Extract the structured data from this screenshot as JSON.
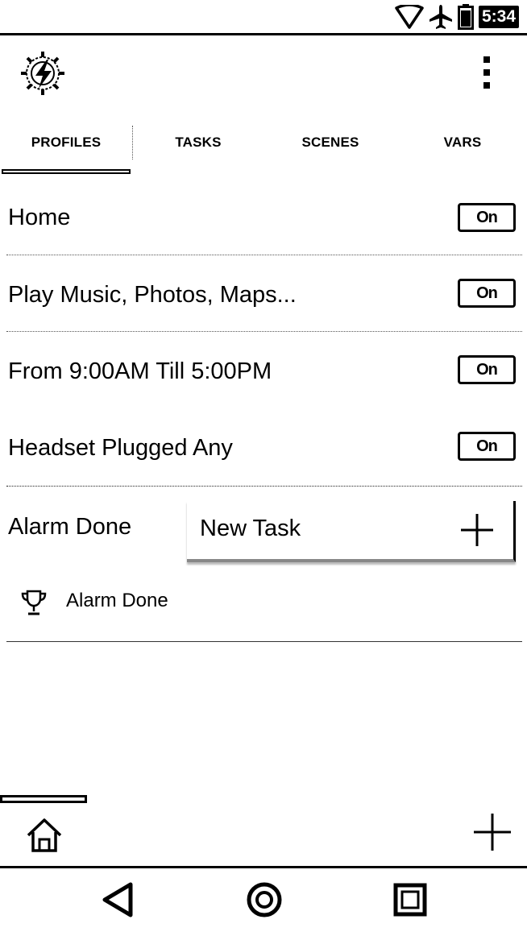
{
  "status_bar": {
    "time": "5:34",
    "icons": [
      "wifi-icon",
      "airplane-icon",
      "battery-icon"
    ]
  },
  "app": {
    "logo_icon": "tasker-gear-lightning-icon",
    "menu_icon": "overflow-menu-icon"
  },
  "tabs": [
    {
      "label": "PROFILES",
      "active": true
    },
    {
      "label": "TASKS",
      "active": false
    },
    {
      "label": "SCENES",
      "active": false
    },
    {
      "label": "VARS",
      "active": false
    }
  ],
  "profiles": [
    {
      "label": "Home",
      "toggle": "On"
    },
    {
      "label": "Play Music, Photos, Maps...",
      "toggle": "On"
    },
    {
      "label": "From  9:00AM Till  5:00PM",
      "toggle": "On"
    },
    {
      "label": "Headset Plugged Any",
      "toggle": "On"
    },
    {
      "label": "Alarm Done"
    }
  ],
  "popup": {
    "label": "New Task",
    "icon": "plus-icon"
  },
  "task": {
    "label": "Alarm Done",
    "icon": "trophy-icon"
  },
  "bottom_bar": {
    "home_icon": "home-icon",
    "add_icon": "plus-icon"
  },
  "nav_bar": {
    "icons": [
      "back-icon",
      "home-circle-icon",
      "recents-icon"
    ]
  }
}
